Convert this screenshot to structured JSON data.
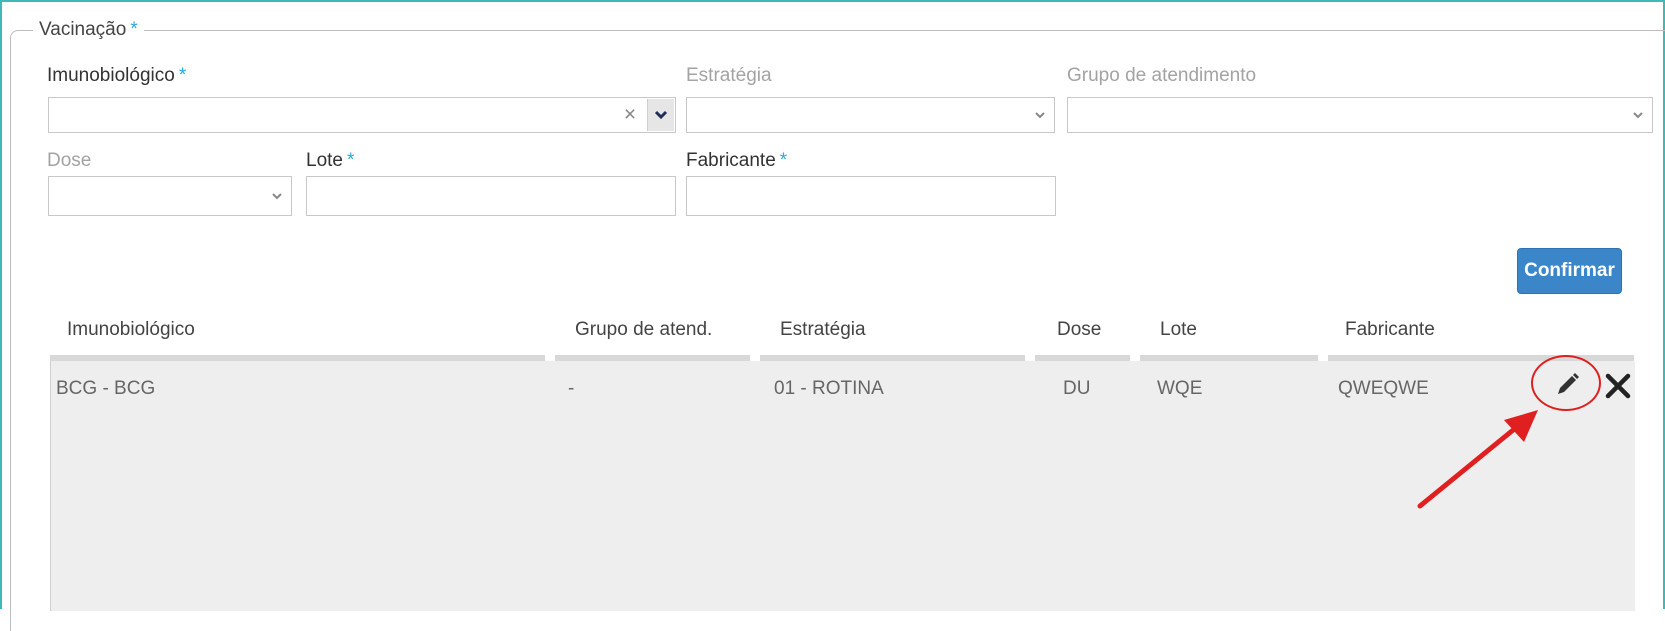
{
  "section": {
    "title": "Vacinação",
    "required_mark": "*"
  },
  "form": {
    "imunobiologico": {
      "label": "Imunobiológico",
      "required_mark": "*",
      "value": "",
      "clear_icon": "close-icon",
      "arrow_icon": "chevron-down-icon"
    },
    "estrategia": {
      "label": "Estratégia",
      "value": "",
      "arrow_icon": "chevron-down-icon"
    },
    "grupo_atendimento": {
      "label": "Grupo de atendimento",
      "value": "",
      "arrow_icon": "chevron-down-icon"
    },
    "dose": {
      "label": "Dose",
      "value": "",
      "arrow_icon": "chevron-down-icon"
    },
    "lote": {
      "label": "Lote",
      "required_mark": "*",
      "value": ""
    },
    "fabricante": {
      "label": "Fabricante",
      "required_mark": "*",
      "value": ""
    },
    "confirm_label": "Confirmar"
  },
  "table": {
    "columns": [
      "Imunobiológico",
      "Grupo de atend.",
      "Estratégia",
      "Dose",
      "Lote",
      "Fabricante"
    ],
    "rows": [
      {
        "cells": [
          "BCG - BCG",
          "-",
          "01 - ROTINA",
          "DU",
          "WQE",
          "QWEQWE"
        ],
        "actions": [
          "pencil-icon",
          "close-icon"
        ]
      }
    ]
  },
  "colors": {
    "accent": "#3a86c8",
    "required": "#2aa9e0",
    "frame": "#3fb9b4",
    "annotation": "#e02020"
  }
}
